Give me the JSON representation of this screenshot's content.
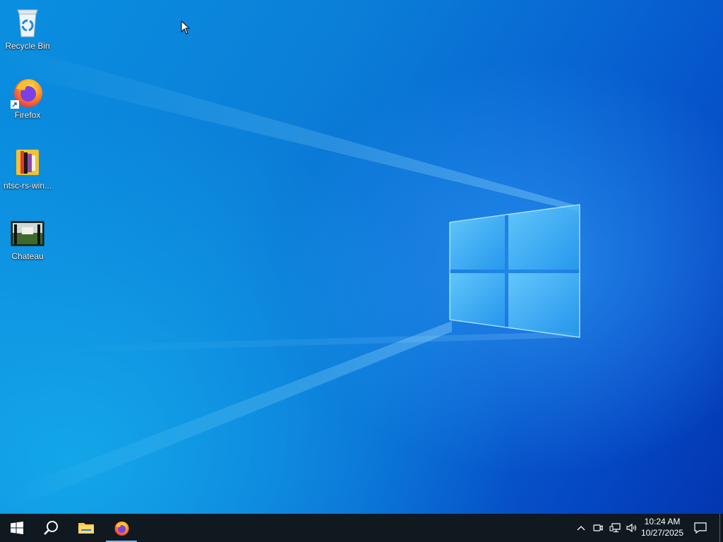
{
  "desktop": {
    "icons": [
      {
        "label": "Recycle Bin",
        "icon": "recycle-bin-icon"
      },
      {
        "label": "Firefox",
        "icon": "firefox-icon",
        "shortcut": true
      },
      {
        "label": "ntsc-rs-win...",
        "icon": "ntsc-rs-icon"
      },
      {
        "label": "Chateau",
        "icon": "image-thumbnail-icon"
      }
    ]
  },
  "taskbar": {
    "buttons": [
      {
        "name": "start",
        "icon": "windows-start-icon"
      },
      {
        "name": "search",
        "icon": "search-icon"
      },
      {
        "name": "file-explorer",
        "icon": "folder-icon"
      },
      {
        "name": "firefox",
        "icon": "firefox-icon",
        "active": true
      }
    ],
    "tray": [
      {
        "name": "show-hidden",
        "icon": "chevron-up-icon"
      },
      {
        "name": "meet-now",
        "icon": "camera-icon"
      },
      {
        "name": "network",
        "icon": "network-icon"
      },
      {
        "name": "volume",
        "icon": "volume-icon"
      }
    ],
    "clock": {
      "time": "10:24 AM",
      "date": "10/27/2025"
    },
    "notifications_icon": "notification-icon"
  },
  "colors": {
    "accent": "#76b9ed",
    "taskbar": "#101820",
    "desktop_blue": "#0b7fd8"
  }
}
